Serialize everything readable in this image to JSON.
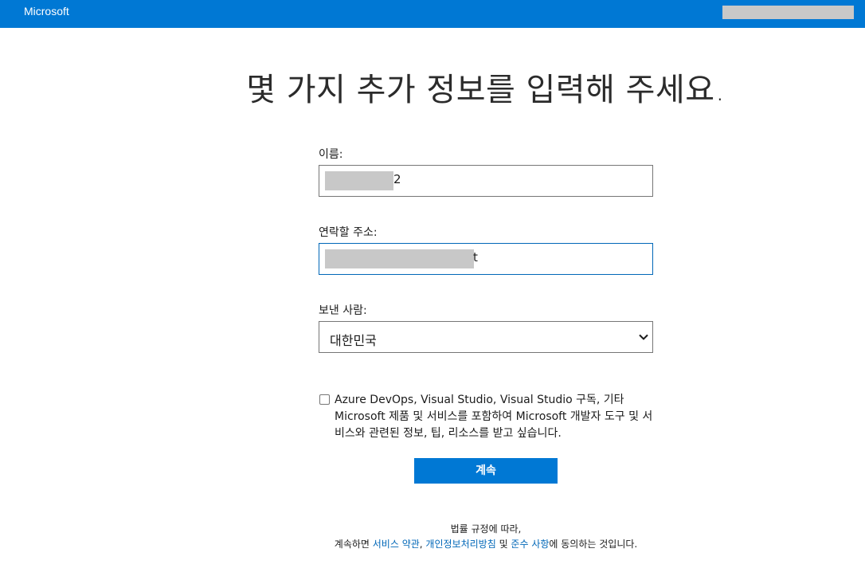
{
  "header": {
    "brand": "Microsoft",
    "account_hidden": true
  },
  "title": "몇 가지 추가 정보를 입력해 주세요.",
  "form": {
    "name_label": "이름:",
    "name_value_visible_tail": "2",
    "email_label": "연락할 주소:",
    "email_value_visible_tail": "t",
    "country_label": "보낸 사람:",
    "country_value": "대한민국",
    "marketing_opt_in_checked": false,
    "marketing_opt_in_text": "Azure DevOps, Visual Studio, Visual Studio 구독, 기타 Microsoft 제품 및 서비스를 포함하여 Microsoft 개발자 도구 및 서비스와 관련된 정보, 팁, 리소스를 받고 싶습니다.",
    "continue_label": "계속"
  },
  "legal": {
    "line1": "법률 규정에 따라,",
    "prefix": "계속하면 ",
    "terms_link": "서비스 약관",
    "comma": ", ",
    "privacy_link": "개인정보처리방침",
    "and": " 및 ",
    "compliance_link": "준수 사항",
    "suffix": "에 동의하는 것입니다."
  },
  "colors": {
    "accent": "#0078d4",
    "link": "#0067b8",
    "redaction": "#c8c8c8"
  }
}
